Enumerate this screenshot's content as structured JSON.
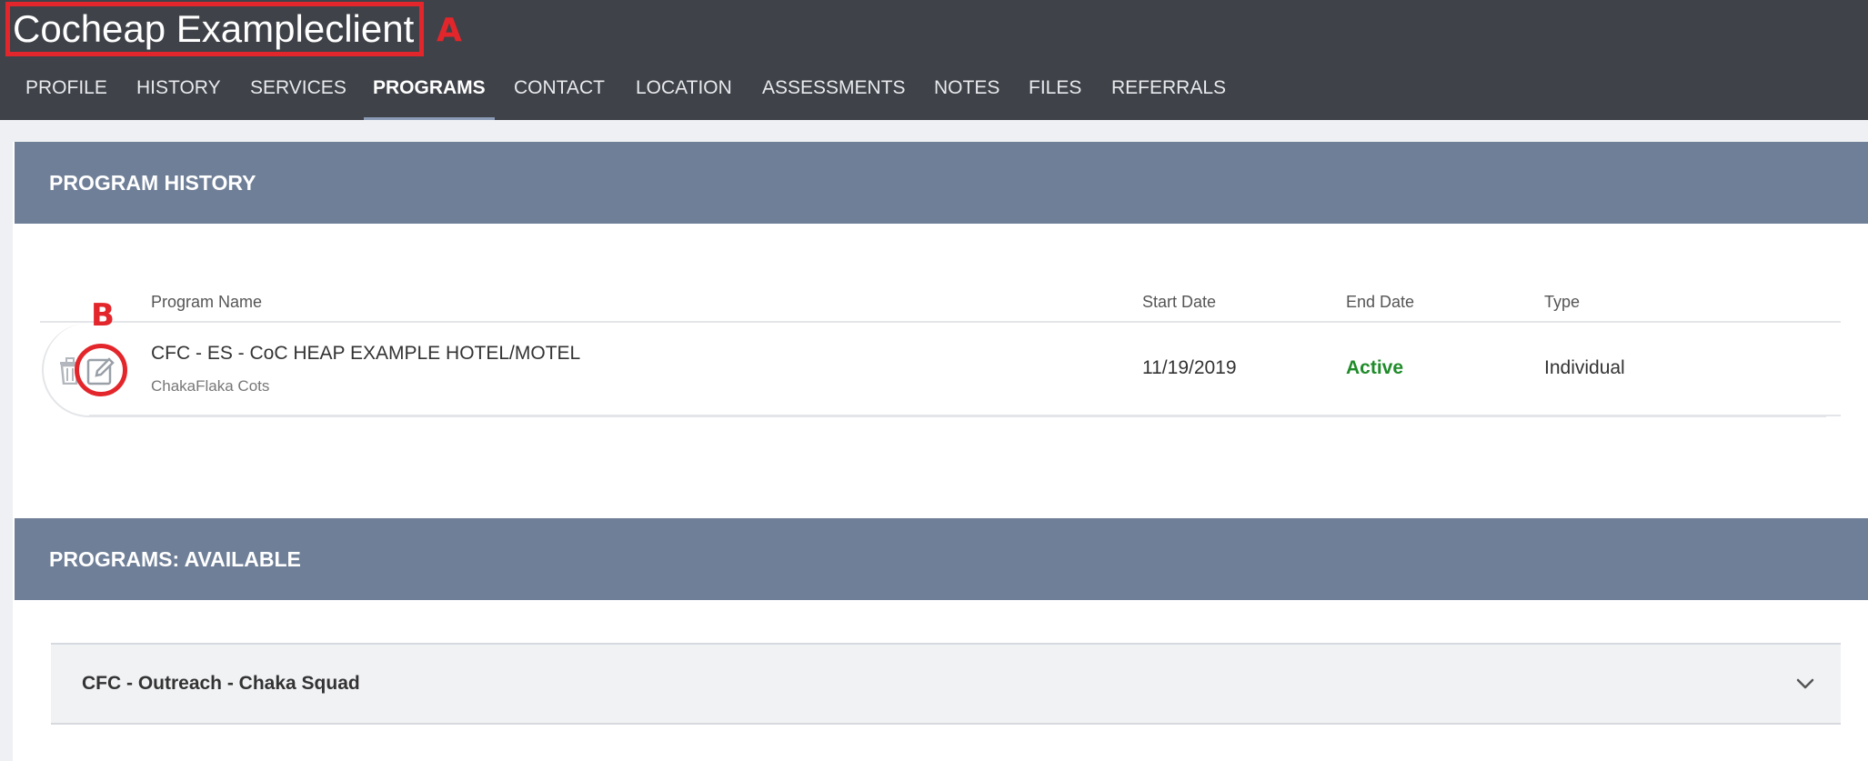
{
  "header": {
    "client_name": "Cocheap Exampleclient",
    "tabs": [
      {
        "label": "PROFILE",
        "active": false
      },
      {
        "label": "HISTORY",
        "active": false
      },
      {
        "label": "SERVICES",
        "active": false
      },
      {
        "label": "PROGRAMS",
        "active": true
      },
      {
        "label": "CONTACT",
        "active": false
      },
      {
        "label": "LOCATION",
        "active": false
      },
      {
        "label": "ASSESSMENTS",
        "active": false
      },
      {
        "label": "NOTES",
        "active": false
      },
      {
        "label": "FILES",
        "active": false
      },
      {
        "label": "REFERRALS",
        "active": false
      }
    ]
  },
  "annotations": {
    "marker_a": "A",
    "marker_b": "B",
    "marker_color": "#e3262b"
  },
  "program_history": {
    "title": "PROGRAM HISTORY",
    "columns": {
      "name": "Program Name",
      "start": "Start Date",
      "end": "End Date",
      "type": "Type"
    },
    "rows": [
      {
        "program_name": "CFC - ES - CoC HEAP EXAMPLE HOTEL/MOTEL",
        "agency": "ChakaFlaka Cots",
        "start_date": "11/19/2019",
        "end_date": "Active",
        "type": "Individual",
        "row_icons": [
          "trash-icon",
          "edit-icon"
        ]
      }
    ]
  },
  "programs_available": {
    "title": "PROGRAMS: AVAILABLE",
    "items": [
      {
        "label": "CFC - Outreach - Chaka Squad",
        "icon": "chevron-down-icon"
      }
    ]
  },
  "colors": {
    "topbar": "#3f4248",
    "section_header": "#6f7f98",
    "active_status": "#1f8b2a",
    "active_tab_underline": "#8b9bb6"
  }
}
